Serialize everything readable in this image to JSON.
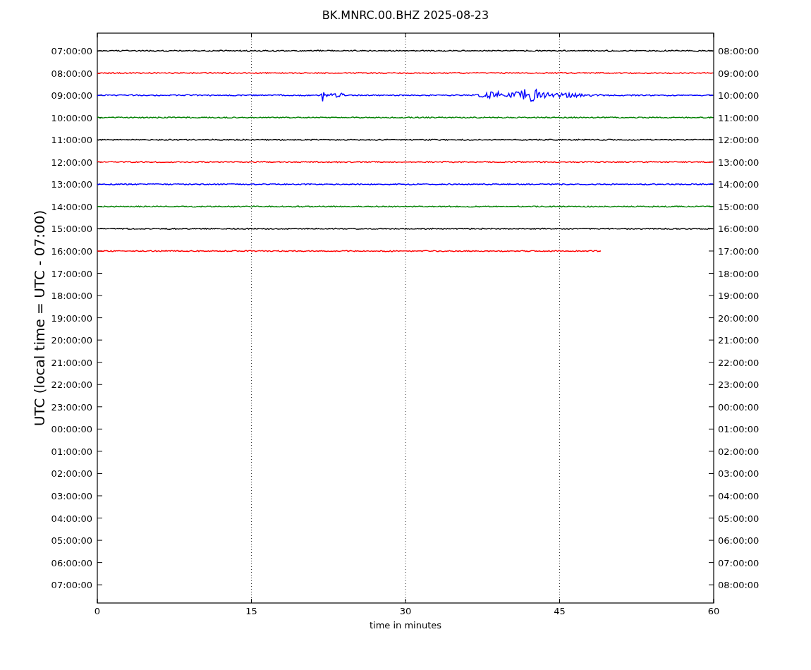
{
  "title": "BK.MNRC.00.BHZ 2025-08-23",
  "ylabel": "UTC (local time = UTC - 07:00)",
  "xlabel": "time in minutes",
  "xticks": [
    "0",
    "15",
    "30",
    "45",
    "60"
  ],
  "left_labels": [
    "07:00:00",
    "08:00:00",
    "09:00:00",
    "10:00:00",
    "11:00:00",
    "12:00:00",
    "13:00:00",
    "14:00:00",
    "15:00:00",
    "16:00:00",
    "17:00:00",
    "18:00:00",
    "19:00:00",
    "20:00:00",
    "21:00:00",
    "22:00:00",
    "23:00:00",
    "00:00:00",
    "01:00:00",
    "02:00:00",
    "03:00:00",
    "04:00:00",
    "05:00:00",
    "06:00:00",
    "07:00:00"
  ],
  "right_labels": [
    "08:00:00",
    "09:00:00",
    "10:00:00",
    "11:00:00",
    "12:00:00",
    "13:00:00",
    "14:00:00",
    "15:00:00",
    "16:00:00",
    "17:00:00",
    "18:00:00",
    "19:00:00",
    "20:00:00",
    "21:00:00",
    "22:00:00",
    "23:00:00",
    "00:00:00",
    "01:00:00",
    "02:00:00",
    "03:00:00",
    "04:00:00",
    "05:00:00",
    "06:00:00",
    "07:00:00",
    "08:00:00"
  ],
  "traces": [
    {
      "kind": "noise",
      "color": "#000000",
      "level": 1
    },
    {
      "kind": "noise",
      "color": "#ff0000",
      "level": 1
    },
    {
      "kind": "event",
      "color": "#0000ff",
      "level": 1
    },
    {
      "kind": "noise",
      "color": "#008000",
      "level": 1
    },
    {
      "kind": "noise",
      "color": "#000000",
      "level": 1
    },
    {
      "kind": "noise",
      "color": "#ff0000",
      "level": 1
    },
    {
      "kind": "noise",
      "color": "#0000ff",
      "level": 1
    },
    {
      "kind": "noise",
      "color": "#008000",
      "level": 1
    },
    {
      "kind": "noise",
      "color": "#000000",
      "level": 1
    },
    {
      "kind": "noise",
      "color": "#ff0000",
      "level": 0.818
    }
  ]
}
